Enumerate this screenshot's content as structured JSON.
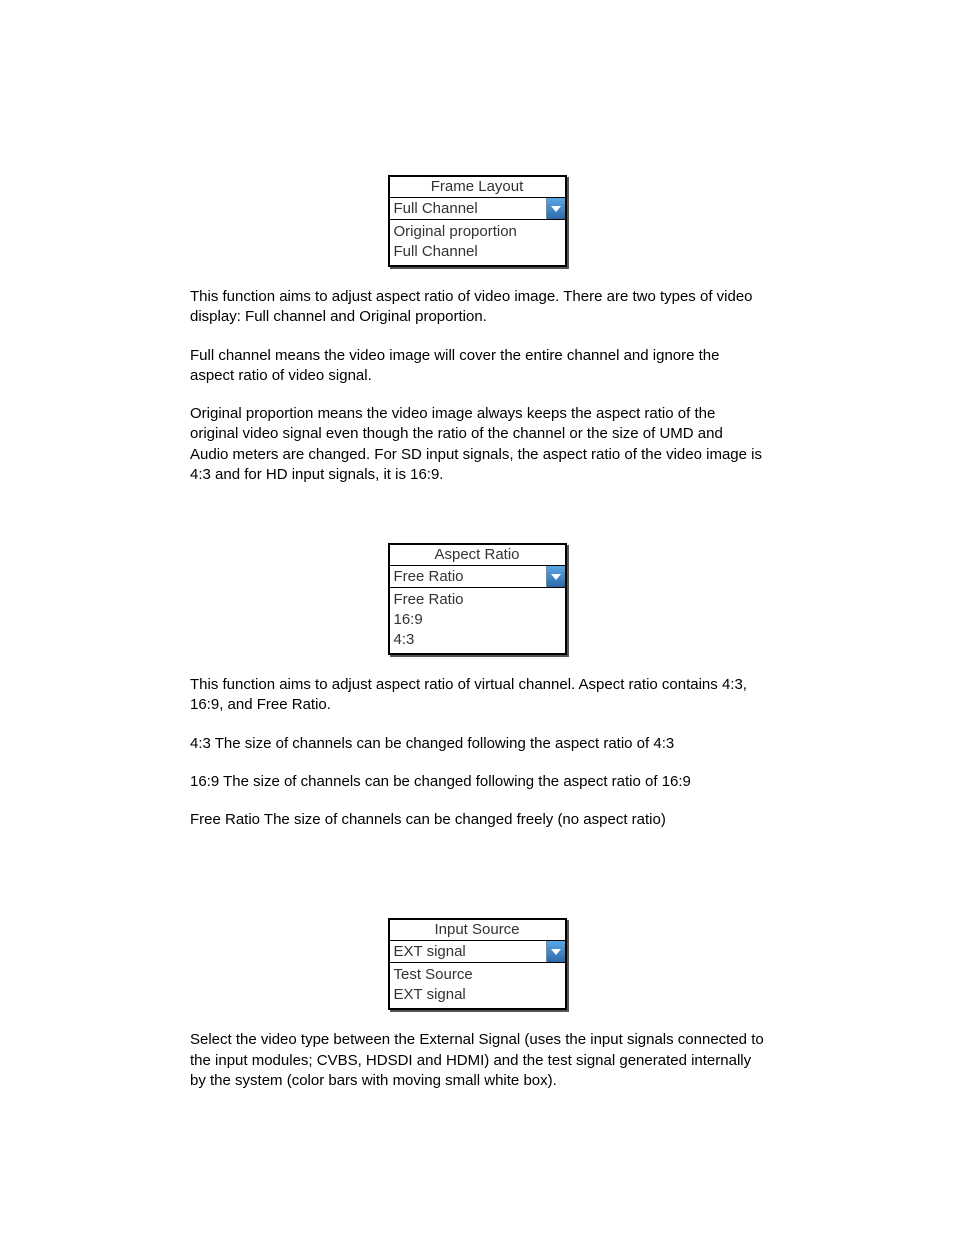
{
  "widgets": {
    "frameLayout": {
      "title": "Frame Layout",
      "selected": "Full Channel",
      "options": [
        "Original proportion",
        "Full Channel"
      ]
    },
    "aspectRatio": {
      "title": "Aspect Ratio",
      "selected": "Free Ratio",
      "options": [
        "Free Ratio",
        "16:9",
        "4:3"
      ]
    },
    "inputSource": {
      "title": "Input Source",
      "selected": "EXT signal",
      "options": [
        "Test Source",
        "EXT signal"
      ]
    }
  },
  "paragraphs": {
    "p1": "This function aims to adjust aspect ratio of video image. There are two types of video display: Full channel and Original proportion.",
    "p2": "Full channel means the video image will cover the entire channel and ignore the aspect ratio of video signal.",
    "p3": "Original proportion means the video image always keeps the aspect ratio of the original video signal even though the ratio of the channel or the size of UMD and Audio meters are changed.  For SD input signals, the aspect ratio of the video image is 4:3 and for HD input signals, it is 16:9.",
    "p4": "This function aims to adjust aspect ratio of virtual channel. Aspect ratio contains 4:3, 16:9, and Free Ratio.",
    "p5": "4:3  The size of channels can be changed following the aspect ratio of 4:3",
    "p6": "16:9   The size of channels can be changed following the aspect ratio of 16:9",
    "p7": "Free Ratio  The size of channels can be changed freely (no aspect ratio)",
    "p8": "Select the video type between the External Signal (uses the input signals connected to the input modules; CVBS, HDSDI and HDMI) and the test signal generated internally by the system (color bars with moving small white box)."
  }
}
